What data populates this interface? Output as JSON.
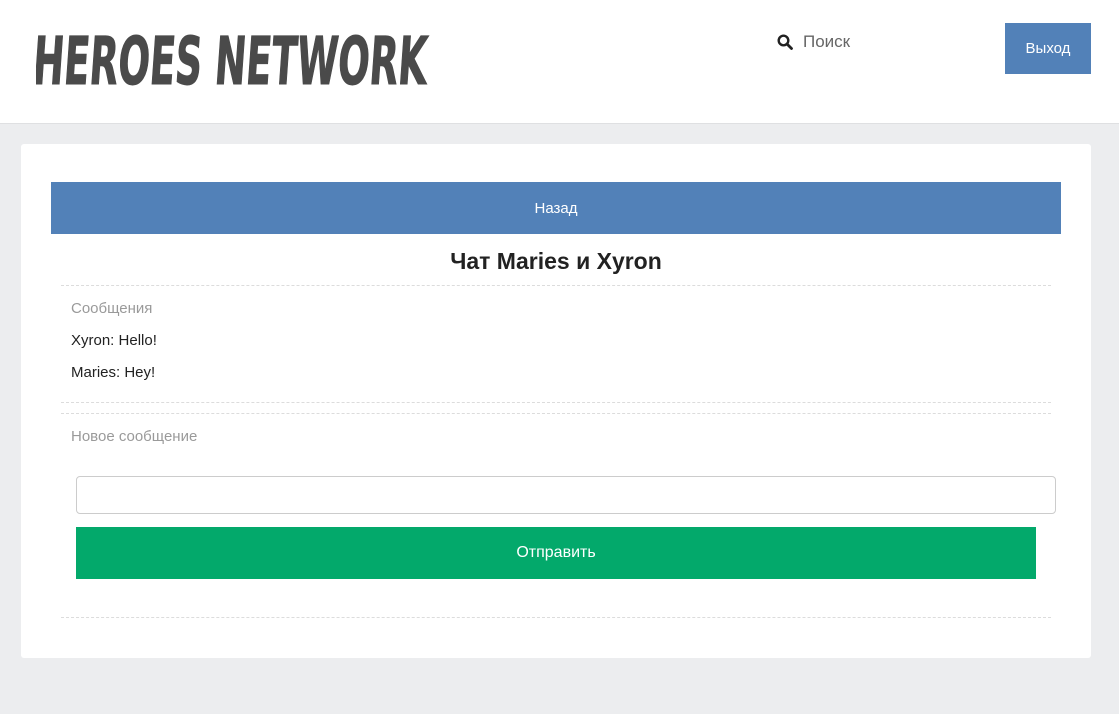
{
  "header": {
    "logo_text": "HEROES NETWORK",
    "search": {
      "icon": "search-icon",
      "placeholder": "Поиск"
    },
    "logout_label": "Выход"
  },
  "chat": {
    "back_label": "Назад",
    "title": "Чат Maries и Xyron",
    "messages_label": "Сообщения",
    "messages": [
      "Xyron: Hello!",
      "Maries: Hey!"
    ],
    "new_message_label": "Новое сообщение",
    "input_value": "",
    "send_label": "Отправить"
  },
  "colors": {
    "primary": "#5281b8",
    "success": "#03a96b",
    "background": "#ecedef",
    "logo": "#4a4a4a"
  }
}
